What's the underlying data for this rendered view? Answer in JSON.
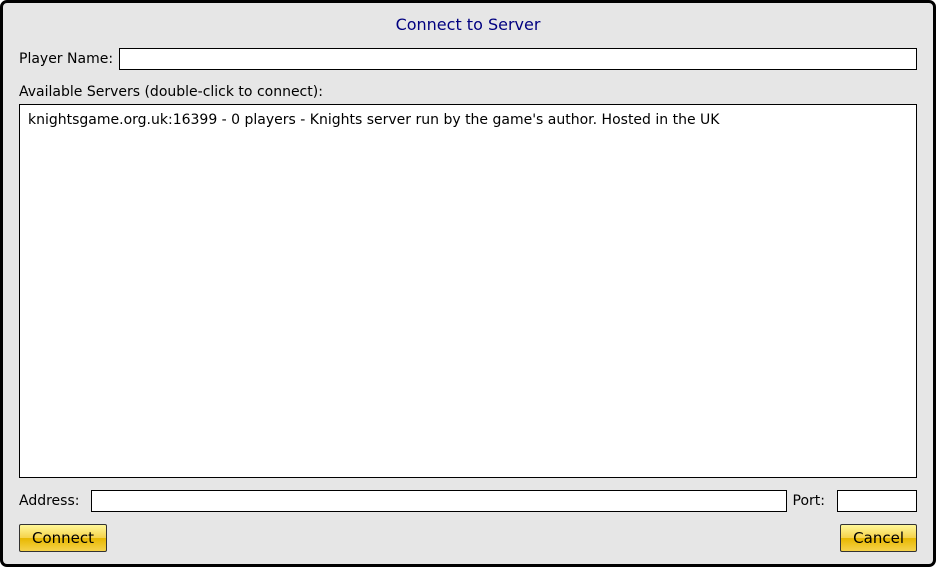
{
  "title": "Connect to Server",
  "playerName": {
    "label": "Player Name:",
    "value": ""
  },
  "serverList": {
    "label": "Available Servers (double-click to connect):",
    "items": [
      "knightsgame.org.uk:16399  -  0 players  -  Knights server run by the game's author. Hosted in the UK"
    ]
  },
  "address": {
    "label": "Address:",
    "value": ""
  },
  "port": {
    "label": "Port:",
    "value": ""
  },
  "buttons": {
    "connect": "Connect",
    "cancel": "Cancel"
  }
}
